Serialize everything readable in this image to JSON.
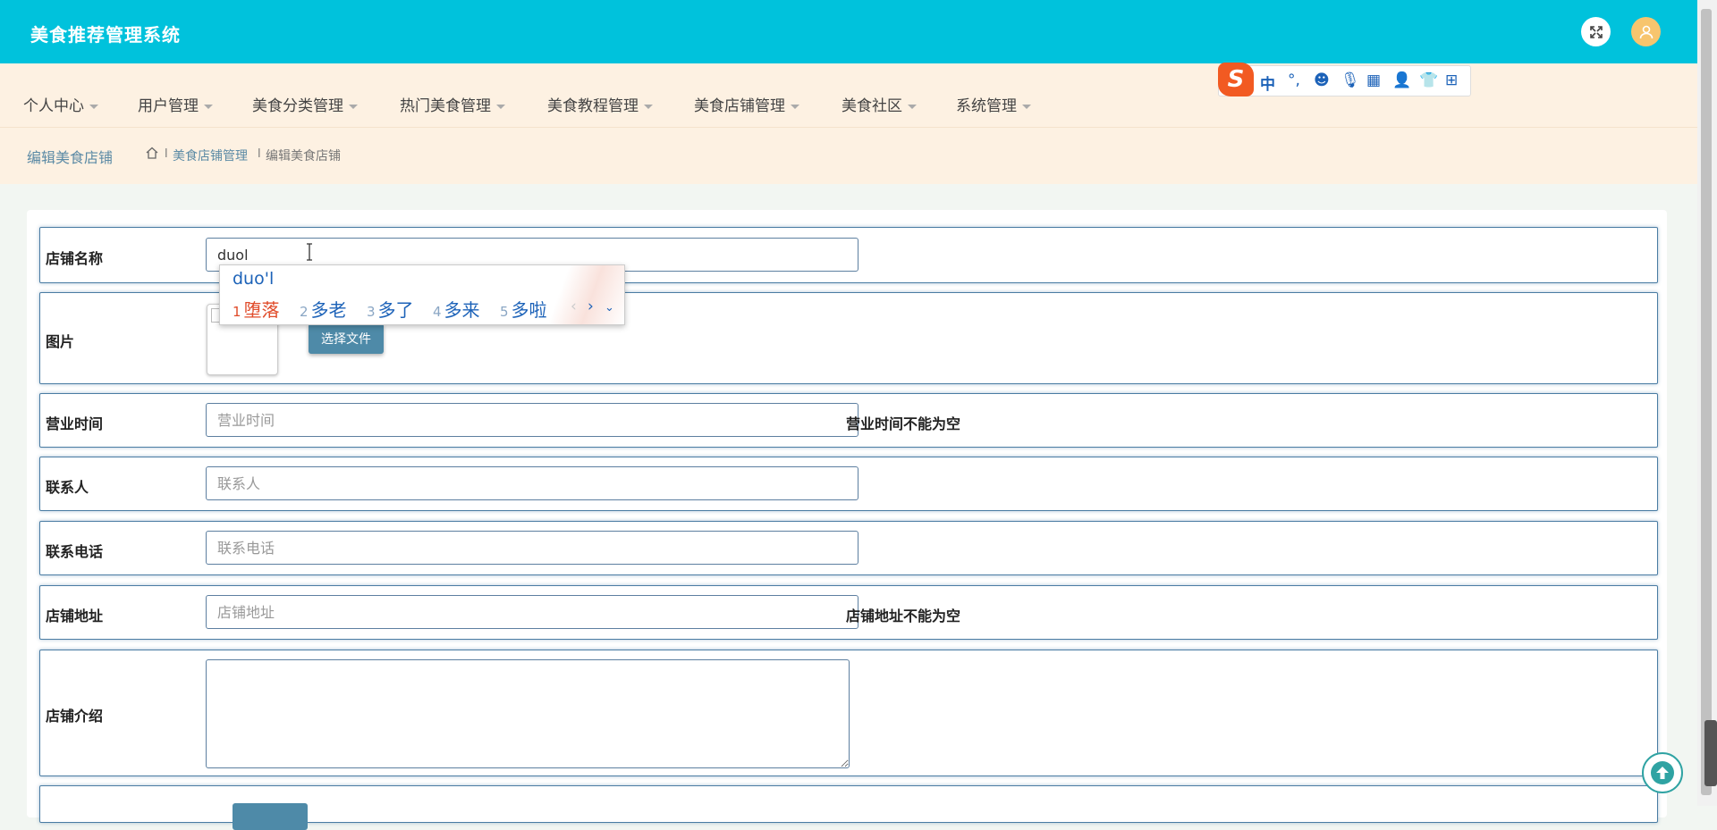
{
  "app": {
    "title": "美食推荐管理系统"
  },
  "nav": {
    "items": [
      "个人中心",
      "用户管理",
      "美食分类管理",
      "热门美食管理",
      "美食教程管理",
      "美食店铺管理",
      "美食社区",
      "系统管理"
    ]
  },
  "breadcrumb": {
    "title": "编辑美食店铺",
    "path": [
      "美食店铺管理",
      "编辑美食店铺"
    ],
    "separator": "l"
  },
  "form": {
    "shop_name": {
      "label": "店铺名称",
      "value": "duol"
    },
    "image": {
      "label": "图片",
      "button": "选择文件"
    },
    "hours": {
      "label": "营业时间",
      "placeholder": "营业时间",
      "error": "营业时间不能为空"
    },
    "contact": {
      "label": "联系人",
      "placeholder": "联系人"
    },
    "phone": {
      "label": "联系电话",
      "placeholder": "联系电话"
    },
    "address": {
      "label": "店铺地址",
      "placeholder": "店铺地址",
      "error": "店铺地址不能为空"
    },
    "intro": {
      "label": "店铺介绍",
      "value": ""
    }
  },
  "ime": {
    "pinyin": "duo'l",
    "candidates": [
      {
        "num": "1",
        "text": "堕落"
      },
      {
        "num": "2",
        "text": "多老"
      },
      {
        "num": "3",
        "text": "多了"
      },
      {
        "num": "4",
        "text": "多来"
      },
      {
        "num": "5",
        "text": "多啦"
      }
    ],
    "toolbar_mode": "中",
    "logo": "S"
  },
  "colors": {
    "header": "#00c2dc",
    "nav_bg": "#fdf1e2",
    "accent": "#4e8aa8",
    "border": "#4a7ca3"
  }
}
